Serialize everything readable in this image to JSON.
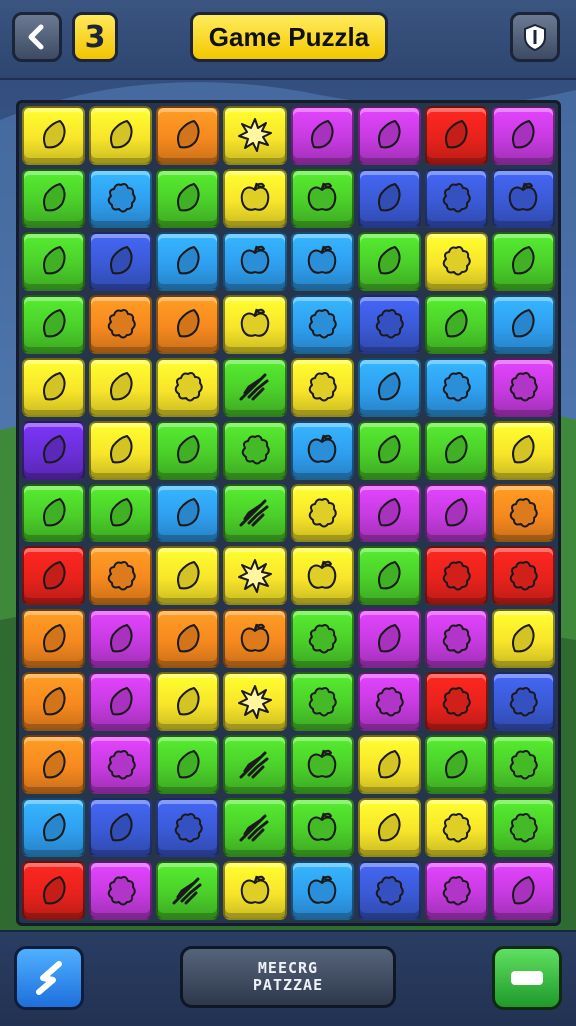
{
  "header": {
    "level": "3",
    "title": "Game Puzzla",
    "back_icon": "chevron-left-icon",
    "pause_icon": "shield-icon"
  },
  "footer": {
    "center_line1": "MEECRG",
    "center_line2": "PATZZAE",
    "left_icon": "lightning-icon",
    "right_icon": "bar-icon"
  },
  "palette": {
    "Y": "#f8e52a",
    "O": "#f6891f",
    "R": "#e8221c",
    "P": "#c63be0",
    "G": "#4bcf2a",
    "B": "#2f9ff0",
    "N": "#3b5ad6",
    "V": "#6b2fd8"
  },
  "board": {
    "columns": 8,
    "rows": 13,
    "tiles": [
      [
        "Y:leaf",
        "Y:leaf",
        "O:leaf",
        "Y:star",
        "P:leaf",
        "P:leaf",
        "R:leaf",
        "P:leaf"
      ],
      [
        "G:leaf",
        "B:blob",
        "G:leaf",
        "Y:apple",
        "G:apple",
        "N:leaf",
        "N:blob",
        "N:apple"
      ],
      [
        "G:leaf",
        "N:leaf",
        "B:leaf",
        "B:apple",
        "B:apple",
        "G:leaf",
        "Y:blob",
        "G:leaf"
      ],
      [
        "G:leaf",
        "O:blob",
        "O:leaf",
        "Y:apple",
        "B:blob",
        "N:blob",
        "G:leaf",
        "B:leaf"
      ],
      [
        "Y:leaf",
        "Y:leaf",
        "Y:blob",
        "G:feather",
        "Y:blob",
        "B:leaf",
        "B:blob",
        "P:blob"
      ],
      [
        "V:leaf",
        "Y:leaf",
        "G:leaf",
        "G:blob",
        "B:apple",
        "G:leaf",
        "G:leaf",
        "Y:leaf"
      ],
      [
        "G:leaf",
        "G:leaf",
        "B:leaf",
        "G:feather",
        "Y:blob",
        "P:leaf",
        "P:leaf",
        "O:blob"
      ],
      [
        "R:leaf",
        "O:blob",
        "Y:leaf",
        "Y:star",
        "Y:apple",
        "G:leaf",
        "R:blob",
        "R:blob"
      ],
      [
        "O:leaf",
        "P:leaf",
        "O:leaf",
        "O:apple",
        "G:blob",
        "P:leaf",
        "P:blob",
        "Y:leaf"
      ],
      [
        "O:leaf",
        "P:leaf",
        "Y:leaf",
        "Y:star",
        "G:blob",
        "P:blob",
        "R:blob",
        "N:blob"
      ],
      [
        "O:leaf",
        "P:blob",
        "G:leaf",
        "G:feather",
        "G:apple",
        "Y:leaf",
        "G:leaf",
        "G:blob"
      ],
      [
        "B:leaf",
        "N:leaf",
        "N:blob",
        "G:feather",
        "G:apple",
        "Y:leaf",
        "Y:blob",
        "G:blob"
      ],
      [
        "R:leaf",
        "P:blob",
        "G:feather",
        "Y:apple",
        "B:apple",
        "N:blob",
        "P:blob",
        "P:leaf"
      ]
    ]
  }
}
